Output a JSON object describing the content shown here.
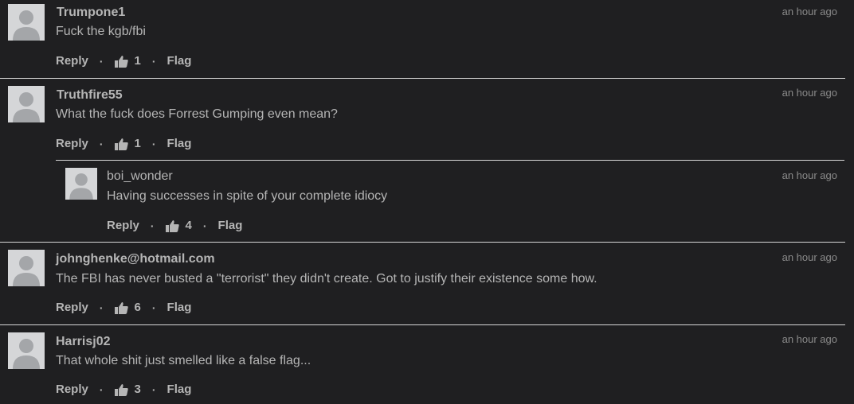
{
  "theme": {
    "background": "#1f1f21",
    "text": "#b5b5b5",
    "muted": "#8a8a8a",
    "divider": "#d8d8d8",
    "avatar": "#d5d6d8"
  },
  "actions": {
    "reply_label": "Reply",
    "flag_label": "Flag",
    "separator": "·",
    "like_icon": "thumbs-up-icon"
  },
  "comments": [
    {
      "author": "Trumpone1",
      "text": "Fuck the kgb/fbi",
      "time": "an hour ago",
      "likes": "1"
    },
    {
      "author": "Truthfire55",
      "text": "What the fuck does Forrest Gumping even mean?",
      "time": "an hour ago",
      "likes": "1"
    },
    {
      "author": "boi_wonder",
      "text": "Having successes in spite of your complete idiocy",
      "time": "an hour ago",
      "likes": "4"
    },
    {
      "author": "johnghenke@hotmail.com",
      "text": "The FBI has never busted a \"terrorist\" they didn't create. Got to justify their existence some how.",
      "time": "an hour ago",
      "likes": "6"
    },
    {
      "author": "Harrisj02",
      "text": "That whole shit just smelled like a false flag...",
      "time": "an hour ago",
      "likes": "3"
    }
  ]
}
